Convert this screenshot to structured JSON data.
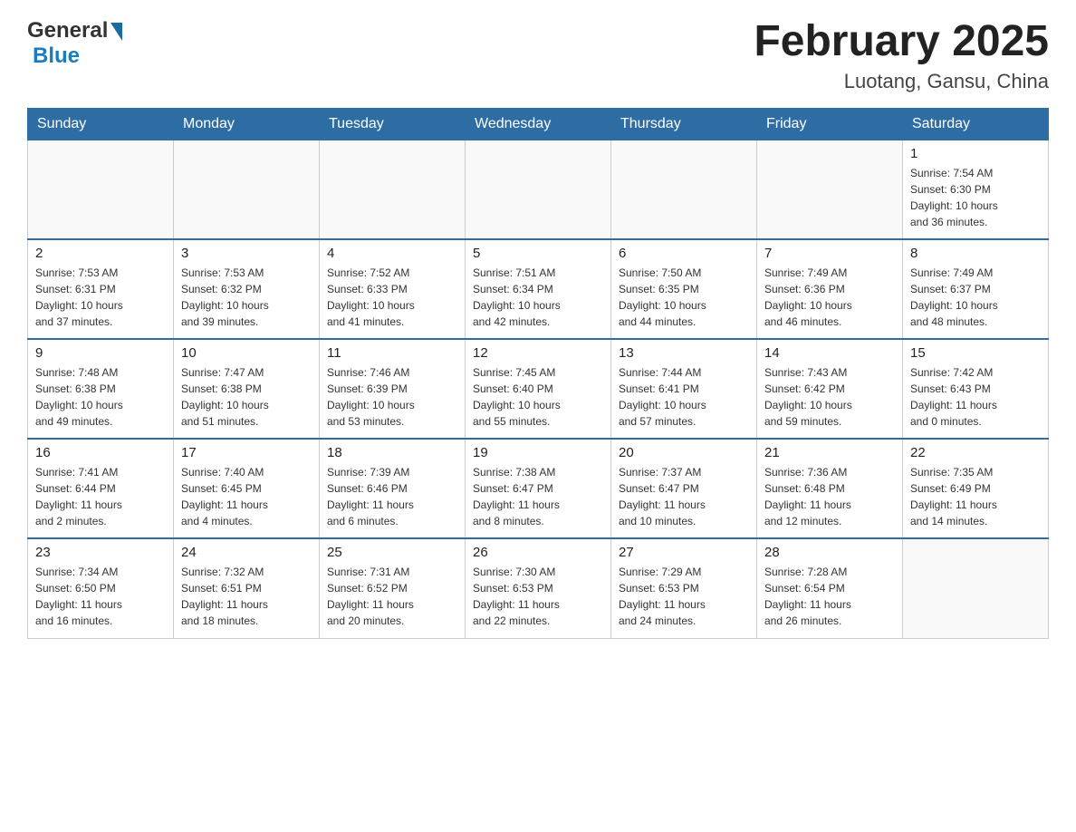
{
  "header": {
    "logo_general": "General",
    "logo_blue": "Blue",
    "month_title": "February 2025",
    "location": "Luotang, Gansu, China"
  },
  "days_of_week": [
    "Sunday",
    "Monday",
    "Tuesday",
    "Wednesday",
    "Thursday",
    "Friday",
    "Saturday"
  ],
  "weeks": [
    {
      "days": [
        {
          "num": "",
          "info": ""
        },
        {
          "num": "",
          "info": ""
        },
        {
          "num": "",
          "info": ""
        },
        {
          "num": "",
          "info": ""
        },
        {
          "num": "",
          "info": ""
        },
        {
          "num": "",
          "info": ""
        },
        {
          "num": "1",
          "info": "Sunrise: 7:54 AM\nSunset: 6:30 PM\nDaylight: 10 hours\nand 36 minutes."
        }
      ]
    },
    {
      "days": [
        {
          "num": "2",
          "info": "Sunrise: 7:53 AM\nSunset: 6:31 PM\nDaylight: 10 hours\nand 37 minutes."
        },
        {
          "num": "3",
          "info": "Sunrise: 7:53 AM\nSunset: 6:32 PM\nDaylight: 10 hours\nand 39 minutes."
        },
        {
          "num": "4",
          "info": "Sunrise: 7:52 AM\nSunset: 6:33 PM\nDaylight: 10 hours\nand 41 minutes."
        },
        {
          "num": "5",
          "info": "Sunrise: 7:51 AM\nSunset: 6:34 PM\nDaylight: 10 hours\nand 42 minutes."
        },
        {
          "num": "6",
          "info": "Sunrise: 7:50 AM\nSunset: 6:35 PM\nDaylight: 10 hours\nand 44 minutes."
        },
        {
          "num": "7",
          "info": "Sunrise: 7:49 AM\nSunset: 6:36 PM\nDaylight: 10 hours\nand 46 minutes."
        },
        {
          "num": "8",
          "info": "Sunrise: 7:49 AM\nSunset: 6:37 PM\nDaylight: 10 hours\nand 48 minutes."
        }
      ]
    },
    {
      "days": [
        {
          "num": "9",
          "info": "Sunrise: 7:48 AM\nSunset: 6:38 PM\nDaylight: 10 hours\nand 49 minutes."
        },
        {
          "num": "10",
          "info": "Sunrise: 7:47 AM\nSunset: 6:38 PM\nDaylight: 10 hours\nand 51 minutes."
        },
        {
          "num": "11",
          "info": "Sunrise: 7:46 AM\nSunset: 6:39 PM\nDaylight: 10 hours\nand 53 minutes."
        },
        {
          "num": "12",
          "info": "Sunrise: 7:45 AM\nSunset: 6:40 PM\nDaylight: 10 hours\nand 55 minutes."
        },
        {
          "num": "13",
          "info": "Sunrise: 7:44 AM\nSunset: 6:41 PM\nDaylight: 10 hours\nand 57 minutes."
        },
        {
          "num": "14",
          "info": "Sunrise: 7:43 AM\nSunset: 6:42 PM\nDaylight: 10 hours\nand 59 minutes."
        },
        {
          "num": "15",
          "info": "Sunrise: 7:42 AM\nSunset: 6:43 PM\nDaylight: 11 hours\nand 0 minutes."
        }
      ]
    },
    {
      "days": [
        {
          "num": "16",
          "info": "Sunrise: 7:41 AM\nSunset: 6:44 PM\nDaylight: 11 hours\nand 2 minutes."
        },
        {
          "num": "17",
          "info": "Sunrise: 7:40 AM\nSunset: 6:45 PM\nDaylight: 11 hours\nand 4 minutes."
        },
        {
          "num": "18",
          "info": "Sunrise: 7:39 AM\nSunset: 6:46 PM\nDaylight: 11 hours\nand 6 minutes."
        },
        {
          "num": "19",
          "info": "Sunrise: 7:38 AM\nSunset: 6:47 PM\nDaylight: 11 hours\nand 8 minutes."
        },
        {
          "num": "20",
          "info": "Sunrise: 7:37 AM\nSunset: 6:47 PM\nDaylight: 11 hours\nand 10 minutes."
        },
        {
          "num": "21",
          "info": "Sunrise: 7:36 AM\nSunset: 6:48 PM\nDaylight: 11 hours\nand 12 minutes."
        },
        {
          "num": "22",
          "info": "Sunrise: 7:35 AM\nSunset: 6:49 PM\nDaylight: 11 hours\nand 14 minutes."
        }
      ]
    },
    {
      "days": [
        {
          "num": "23",
          "info": "Sunrise: 7:34 AM\nSunset: 6:50 PM\nDaylight: 11 hours\nand 16 minutes."
        },
        {
          "num": "24",
          "info": "Sunrise: 7:32 AM\nSunset: 6:51 PM\nDaylight: 11 hours\nand 18 minutes."
        },
        {
          "num": "25",
          "info": "Sunrise: 7:31 AM\nSunset: 6:52 PM\nDaylight: 11 hours\nand 20 minutes."
        },
        {
          "num": "26",
          "info": "Sunrise: 7:30 AM\nSunset: 6:53 PM\nDaylight: 11 hours\nand 22 minutes."
        },
        {
          "num": "27",
          "info": "Sunrise: 7:29 AM\nSunset: 6:53 PM\nDaylight: 11 hours\nand 24 minutes."
        },
        {
          "num": "28",
          "info": "Sunrise: 7:28 AM\nSunset: 6:54 PM\nDaylight: 11 hours\nand 26 minutes."
        },
        {
          "num": "",
          "info": ""
        }
      ]
    }
  ]
}
